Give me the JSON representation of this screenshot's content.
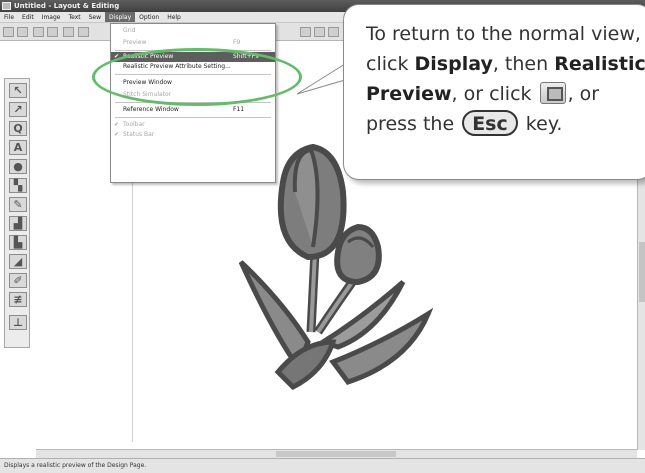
{
  "window": {
    "title": "Untitled - Layout & Editing"
  },
  "menubar": {
    "items": [
      "File",
      "Edit",
      "Image",
      "Text",
      "Sew",
      "Display",
      "Option",
      "Help"
    ],
    "active": "Display"
  },
  "display_menu": {
    "items": [
      {
        "label": "Grid",
        "shortcut": "",
        "state": "disabled",
        "checked": false
      },
      {
        "label": "Preview",
        "shortcut": "F9",
        "state": "disabled",
        "checked": false
      },
      {
        "label": "Realistic Preview",
        "shortcut": "Shift+F9",
        "state": "highlight",
        "checked": true
      },
      {
        "label": "Realistic Preview Attribute Setting...",
        "shortcut": "",
        "state": "normal",
        "checked": false
      },
      {
        "label": "Preview Window",
        "shortcut": "",
        "state": "normal",
        "checked": false
      },
      {
        "label": "Stitch Simulator",
        "shortcut": "",
        "state": "disabled",
        "checked": false
      },
      {
        "label": "Reference Window",
        "shortcut": "F11",
        "state": "normal",
        "checked": false
      },
      {
        "label": "Toolbar",
        "shortcut": "",
        "state": "disabled",
        "checked": true
      },
      {
        "label": "Status Bar",
        "shortcut": "",
        "state": "disabled",
        "checked": true
      }
    ]
  },
  "callout": {
    "line1": "To return to the normal view,",
    "line2_prefix": "click ",
    "line2_bold1": "Display",
    "line2_mid": ", then ",
    "line2_bold2": "Realistic",
    "line3_bold": "Preview",
    "line3_suffix": ", or click ",
    "line3_end": ", or",
    "line4_prefix": "press the ",
    "esc_label": "Esc",
    "line4_suffix": " key."
  },
  "palette": {
    "tools": [
      "select-arrow",
      "point-edit",
      "zoom",
      "text",
      "shape",
      "paint",
      "brush",
      "eraser",
      "fill",
      "stamp",
      "pen",
      "stitch",
      "sew-point"
    ]
  },
  "status": {
    "text": "Displays a realistic preview of the Design Page."
  },
  "colors": {
    "highlight_oval": "#5fbf66",
    "menu_highlight": "#5e5e5e",
    "flower_fill": "#7f7f7f",
    "flower_outline": "#4a4a4a"
  }
}
